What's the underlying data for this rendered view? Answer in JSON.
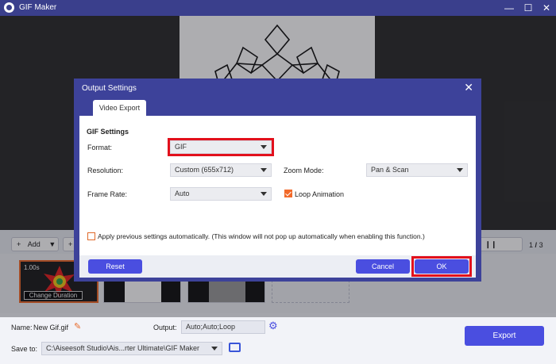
{
  "window": {
    "title": "GIF Maker",
    "minimize": "—",
    "maximize": "☐",
    "close": "✕"
  },
  "toolbar": {
    "add_label": "Add",
    "add_icon": "+",
    "add2_icon": "+",
    "pause_icon": "❙❙"
  },
  "pager": {
    "current": "1",
    "separator": "/",
    "total": "3"
  },
  "thumbs": {
    "duration": "1.00s",
    "change_duration": "Change Duration"
  },
  "bottom": {
    "name_label": "Name:",
    "name_value": "New Gif.gif",
    "output_label": "Output:",
    "output_value": "Auto;Auto;Loop",
    "save_label": "Save to:",
    "save_value": "C:\\Aiseesoft Studio\\Ais...rter Ultimate\\GIF Maker",
    "export_label": "Export"
  },
  "dialog": {
    "title": "Output Settings",
    "tab": "Video Export",
    "section": "GIF Settings",
    "format_label": "Format:",
    "format_value": "GIF",
    "resolution_label": "Resolution:",
    "resolution_value": "Custom (655x712)",
    "zoom_label": "Zoom Mode:",
    "zoom_value": "Pan & Scan",
    "framerate_label": "Frame Rate:",
    "framerate_value": "Auto",
    "loop_label": "Loop Animation",
    "loop_checked": true,
    "apply_label": "Apply previous settings automatically. (This window will not pop up automatically when enabling this function.)",
    "apply_checked": false,
    "reset_label": "Reset",
    "cancel_label": "Cancel",
    "ok_label": "OK"
  },
  "colors": {
    "accent": "#4a4ee0",
    "titlebar": "#3a3f8c",
    "dialog": "#3d429a",
    "highlight": "#e2101c",
    "checkbox": "#f26a2a"
  }
}
